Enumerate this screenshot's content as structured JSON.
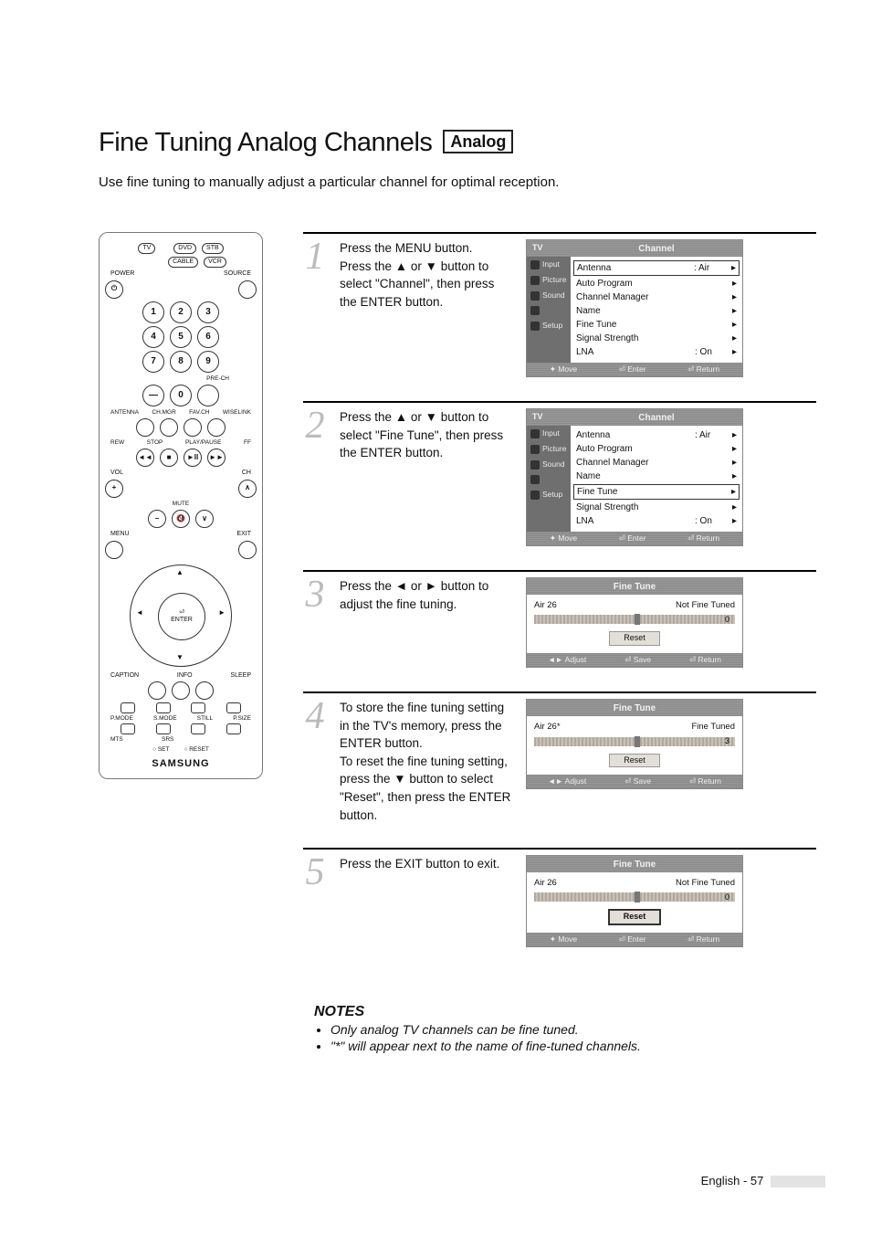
{
  "title": "Fine Tuning Analog Channels",
  "badge": "Analog",
  "intro": "Use fine tuning to manually adjust a particular channel for optimal reception.",
  "remote": {
    "modes_top": [
      "DVD",
      "STB"
    ],
    "modes_bot": [
      "CABLE",
      "VCR"
    ],
    "tv": "TV",
    "power": "POWER",
    "source": "SOURCE",
    "digits": [
      "1",
      "2",
      "3",
      "4",
      "5",
      "6",
      "7",
      "8",
      "9",
      "—",
      "0"
    ],
    "prech": "PRE-CH",
    "row_labels": [
      "ANTENNA",
      "CH.MGR",
      "FAV.CH",
      "WISELINK"
    ],
    "transport": [
      "REW",
      "STOP",
      "PLAY/PAUSE",
      "FF"
    ],
    "vol": "VOL",
    "ch": "CH",
    "mute": "MUTE",
    "menu": "MENU",
    "exit": "EXIT",
    "enter": "ENTER",
    "caption": "CAPTION",
    "info": "INFO",
    "sleep": "SLEEP",
    "row_b": [
      "P.MODE",
      "S.MODE",
      "STILL",
      "P.SIZE"
    ],
    "row_c": [
      "MTS",
      "SRS"
    ],
    "set": "SET",
    "reset": "RESET",
    "brand": "SAMSUNG"
  },
  "steps": [
    {
      "num": "1",
      "text": "Press the MENU button.\nPress the ▲ or ▼ button to select \"Channel\", then press the ENTER button.",
      "screen": {
        "type": "channel",
        "tv": "TV",
        "title": "Channel",
        "sidebar": [
          "Input",
          "Picture",
          "Sound",
          "",
          "Setup"
        ],
        "rows": [
          {
            "label": "Antenna",
            "val": ": Air",
            "arr": "▸",
            "boxed": true
          },
          {
            "label": "Auto Program",
            "val": "",
            "arr": "▸"
          },
          {
            "label": "Channel Manager",
            "val": "",
            "arr": "▸"
          },
          {
            "label": "Name",
            "val": "",
            "arr": "▸"
          },
          {
            "label": "Fine Tune",
            "val": "",
            "arr": "▸"
          },
          {
            "label": "Signal Strength",
            "val": "",
            "arr": "▸"
          },
          {
            "label": "LNA",
            "val": ": On",
            "arr": "▸"
          }
        ],
        "footer": [
          "✦ Move",
          "⏎ Enter",
          "⏎ Return"
        ]
      }
    },
    {
      "num": "2",
      "text": "Press the ▲ or ▼ button to select \"Fine Tune\", then press the ENTER button.",
      "screen": {
        "type": "channel",
        "tv": "TV",
        "title": "Channel",
        "sidebar": [
          "Input",
          "Picture",
          "Sound",
          "",
          "Setup"
        ],
        "rows": [
          {
            "label": "Antenna",
            "val": ": Air",
            "arr": "▸"
          },
          {
            "label": "Auto Program",
            "val": "",
            "arr": "▸"
          },
          {
            "label": "Channel Manager",
            "val": "",
            "arr": "▸"
          },
          {
            "label": "Name",
            "val": "",
            "arr": "▸"
          },
          {
            "label": "Fine Tune",
            "val": "",
            "arr": "▸",
            "boxed": true
          },
          {
            "label": "Signal Strength",
            "val": "",
            "arr": "▸"
          },
          {
            "label": "LNA",
            "val": ": On",
            "arr": "▸"
          }
        ],
        "footer": [
          "✦ Move",
          "⏎ Enter",
          "⏎ Return"
        ]
      }
    },
    {
      "num": "3",
      "text": "Press the ◄ or ► button to adjust the fine tuning.",
      "screen": {
        "type": "ft",
        "title": "Fine Tune",
        "ch": "Air 26",
        "status": "Not Fine Tuned",
        "value": "0",
        "reset": "Reset",
        "reset_strong": false,
        "footer": [
          "◄► Adjust",
          "⏎ Save",
          "⏎ Return"
        ]
      }
    },
    {
      "num": "4",
      "text": "To store the fine tuning setting in the TV's memory, press the ENTER button.\nTo reset the fine tuning setting, press the ▼ button to select \"Reset\", then press the ENTER button.",
      "screen": {
        "type": "ft",
        "title": "Fine Tune",
        "ch": "Air 26*",
        "status": "Fine Tuned",
        "value": "3",
        "reset": "Reset",
        "reset_strong": false,
        "footer": [
          "◄► Adjust",
          "⏎ Save",
          "⏎ Return"
        ]
      }
    },
    {
      "num": "5",
      "text": "Press the EXIT button to exit.",
      "screen": {
        "type": "ft",
        "title": "Fine Tune",
        "ch": "Air 26",
        "status": "Not Fine Tuned",
        "value": "0",
        "reset": "Reset",
        "reset_strong": true,
        "footer": [
          "✦ Move",
          "⏎ Enter",
          "⏎ Return"
        ]
      }
    }
  ],
  "notes": {
    "head": "NOTES",
    "items": [
      "Only analog TV channels can be fine tuned.",
      "\"*\" will appear next to the name of fine-tuned channels."
    ]
  },
  "footer": {
    "lang": "English",
    "sep": "-",
    "page": "57"
  }
}
